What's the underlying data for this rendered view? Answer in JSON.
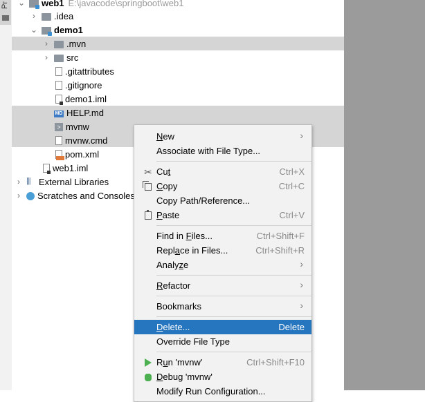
{
  "stripe": {
    "tab_label": "Pr"
  },
  "tree": {
    "rows": [
      {
        "label": "web1",
        "path": "E:\\javacode\\springboot\\web1"
      },
      {
        "label": ".idea"
      },
      {
        "label": "demo1"
      },
      {
        "label": ".mvn"
      },
      {
        "label": "src"
      },
      {
        "label": ".gitattributes"
      },
      {
        "label": ".gitignore"
      },
      {
        "label": "demo1.iml"
      },
      {
        "label": "HELP.md",
        "icon_text": "MD"
      },
      {
        "label": "mvnw",
        "icon_text": ">"
      },
      {
        "label": "mvnw.cmd"
      },
      {
        "label": "pom.xml"
      },
      {
        "label": "web1.iml"
      },
      {
        "label": "External Libraries",
        "icon_text": "|||"
      },
      {
        "label": "Scratches and Consoles"
      }
    ]
  },
  "menu": {
    "new": {
      "pre": "",
      "key": "N",
      "post": "ew"
    },
    "associate": {
      "pre": "Associate with File Type...",
      "key": "",
      "post": ""
    },
    "cut": {
      "pre": "Cu",
      "key": "t",
      "post": "",
      "shortcut": "Ctrl+X"
    },
    "copy": {
      "pre": "",
      "key": "C",
      "post": "opy",
      "shortcut": "Ctrl+C"
    },
    "copy_path": {
      "pre": "Copy Path/Reference...",
      "key": "",
      "post": ""
    },
    "paste": {
      "pre": "",
      "key": "P",
      "post": "aste",
      "shortcut": "Ctrl+V"
    },
    "find": {
      "pre": "Find in ",
      "key": "F",
      "post": "iles...",
      "shortcut": "Ctrl+Shift+F"
    },
    "replace": {
      "pre": "Repl",
      "key": "a",
      "post": "ce in Files...",
      "shortcut": "Ctrl+Shift+R"
    },
    "analyze": {
      "pre": "Analy",
      "key": "z",
      "post": "e"
    },
    "refactor": {
      "pre": "",
      "key": "R",
      "post": "efactor"
    },
    "bookmarks": {
      "pre": "Bookmarks",
      "key": "",
      "post": ""
    },
    "delete": {
      "pre": "",
      "key": "D",
      "post": "elete...",
      "shortcut": "Delete"
    },
    "override": {
      "pre": "Override File Type",
      "key": "",
      "post": ""
    },
    "run": {
      "pre": "R",
      "key": "u",
      "post": "n 'mvnw'",
      "shortcut": "Ctrl+Shift+F10"
    },
    "debug": {
      "pre": "",
      "key": "D",
      "post": "ebug 'mvnw'"
    },
    "modify": {
      "pre": "Modify Run Configuration...",
      "key": "",
      "post": ""
    }
  },
  "colors": {
    "highlight": "#2675bf",
    "selection_row": "#d5d5d5",
    "menu_bg": "#f2f2f2"
  }
}
